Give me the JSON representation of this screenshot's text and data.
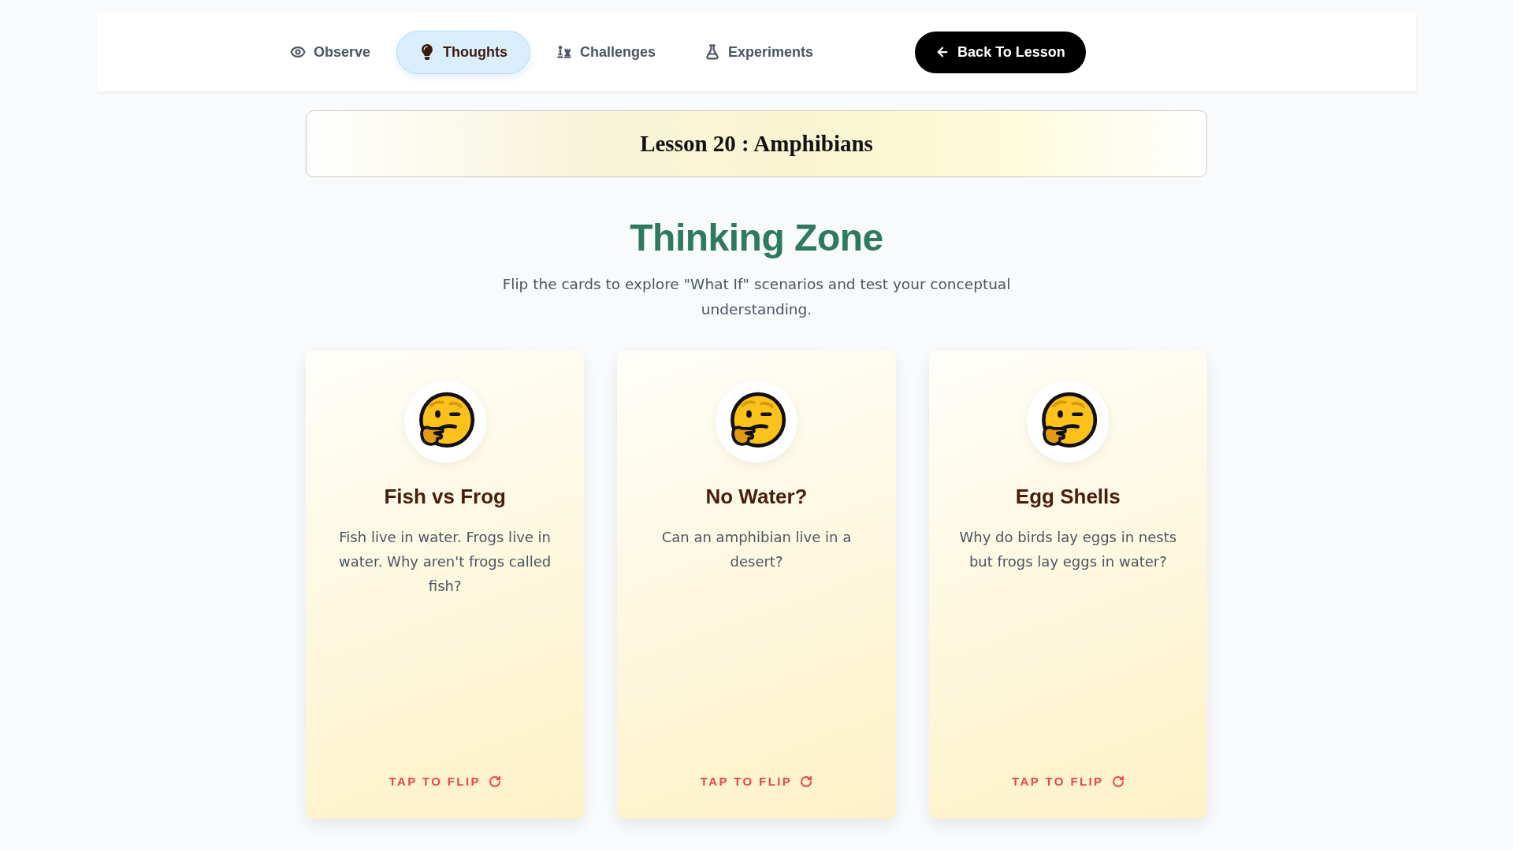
{
  "nav": {
    "tabs": [
      {
        "label": "Observe",
        "selected": false
      },
      {
        "label": "Thoughts",
        "selected": true
      },
      {
        "label": "Challenges",
        "selected": false
      },
      {
        "label": "Experiments",
        "selected": false
      }
    ],
    "back_button": {
      "label": "Back To Lesson"
    }
  },
  "lesson_title": "Lesson 20 : Amphibians",
  "section": {
    "heading": "Thinking Zone",
    "subtitle": "Flip the cards to explore \"What If\" scenarios and test your conceptual understanding."
  },
  "cards": [
    {
      "title": "Fish vs Frog",
      "question": "Fish live in water. Frogs live in water. Why aren't frogs called fish?",
      "flip_label": "TAP TO FLIP"
    },
    {
      "title": "No Water?",
      "question": "Can an amphibian live in a desert?",
      "flip_label": "TAP TO FLIP"
    },
    {
      "title": "Egg Shells",
      "question": "Why do birds lay eggs in nests but frogs lay eggs in water?",
      "flip_label": "TAP TO FLIP"
    }
  ]
}
